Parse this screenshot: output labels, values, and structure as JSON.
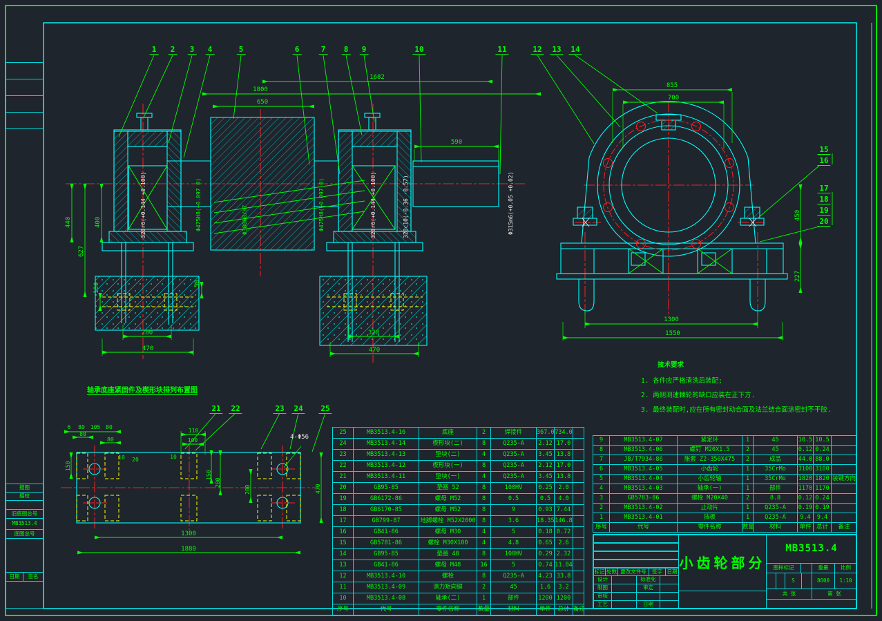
{
  "page": {
    "bg": "#1f252d",
    "line_cyan": "#00ffff",
    "line_green": "#00ff00",
    "line_red": "#ff0000",
    "line_yellow": "#ffff00",
    "line_white": "#e9e9e9"
  },
  "balloons": [
    "1",
    "2",
    "3",
    "4",
    "5",
    "6",
    "7",
    "8",
    "9",
    "10",
    "11",
    "12",
    "13",
    "14",
    "15",
    "16",
    "17",
    "18",
    "19",
    "20",
    "21",
    "22",
    "23",
    "24",
    "25"
  ],
  "dims": {
    "main": {
      "d1682": "1682",
      "d1800": "1800",
      "d650": "650",
      "d590": "590",
      "d440": "440",
      "d400": "400",
      "d627": "627",
      "d100": "100",
      "d50": "50",
      "d280": "280",
      "d470a": "470",
      "d320": "320",
      "d470b": "470"
    },
    "right_view": {
      "d855": "855",
      "d700": "700",
      "d450": "450",
      "d227": "227",
      "d1300": "1300",
      "d1550": "1550"
    },
    "plan": {
      "d110": "110",
      "d100": "100",
      "d6": "6",
      "d80a": "80",
      "d105": "105",
      "d80b": "80",
      "d80c": "80",
      "d80d": "80",
      "d150a": "150",
      "d10a": "10",
      "d20": "20",
      "d10b": "10",
      "d150b": "150",
      "d200": "200",
      "d280": "280",
      "d470": "470",
      "d1300": "1300",
      "d1880": "1880",
      "dholes": "4-Φ56"
    }
  },
  "fits": {
    "f475a": "Φ475H8(+0.097 0)",
    "f380": "Φ380H8/h7",
    "f475b": "Φ475H8(+0.097 0)",
    "f320ra": "320r6(+0.144 +0.100)",
    "f320rb": "320r6(+0.144 +0.100)",
    "f320c": "320c10(-0.36 -0.57)",
    "f315": "Φ315m6(+0.05 +0.02)"
  },
  "notes": {
    "heading": "技术要求",
    "items": [
      "1. 各件应严格清洗后装配;",
      "2. 两侧测速棘轮的缺口应装在正下方.",
      "3. 最终装配时,应在所有密封动合面及法兰结合面涂密封不干胶."
    ]
  },
  "caption_plan": "轴承底座紧固件及楔形块排列布置图",
  "bom_left": {
    "headers": [
      "序号",
      "代号",
      "零件名称",
      "数量",
      "材料",
      "单件",
      "总计",
      "备注"
    ],
    "rows": [
      {
        "no": "25",
        "code": "MB3513.4-16",
        "name": "底座",
        "qty": "2",
        "mat": "焊接件",
        "unit": "367.0",
        "total": "734.0",
        "rem": ""
      },
      {
        "no": "24",
        "code": "MB3513.4-14",
        "name": "楔形块(二)",
        "qty": "8",
        "mat": "Q235-A",
        "unit": "2.12",
        "total": "17.0",
        "rem": ""
      },
      {
        "no": "23",
        "code": "MB3513.4-13",
        "name": "垫块(二)",
        "qty": "4",
        "mat": "Q235-A",
        "unit": "3.45",
        "total": "13.8",
        "rem": ""
      },
      {
        "no": "22",
        "code": "MB3513.4-12",
        "name": "楔形块(一)",
        "qty": "8",
        "mat": "Q235-A",
        "unit": "2.12",
        "total": "17.0",
        "rem": ""
      },
      {
        "no": "21",
        "code": "MB3513.4-11",
        "name": "垫块(一)",
        "qty": "4",
        "mat": "Q235-A",
        "unit": "3.45",
        "total": "13.8",
        "rem": ""
      },
      {
        "no": "20",
        "code": "GB95-85",
        "name": "垫圈 52",
        "qty": "8",
        "mat": "100HV",
        "unit": "0.25",
        "total": "2.0",
        "rem": ""
      },
      {
        "no": "19",
        "code": "GB6172-86",
        "name": "螺母 M52",
        "qty": "8",
        "mat": "0.5",
        "unit": "0.5",
        "total": "4.0",
        "rem": ""
      },
      {
        "no": "18",
        "code": "GB6170-85",
        "name": "螺母 M52",
        "qty": "8",
        "mat": "9",
        "unit": "0.93",
        "total": "7.44",
        "rem": ""
      },
      {
        "no": "17",
        "code": "GB799-87",
        "name": "地脚螺栓 M52X2000",
        "qty": "8",
        "mat": "3.6",
        "unit": "18.35",
        "total": "146.8",
        "rem": ""
      },
      {
        "no": "16",
        "code": "GB41-86",
        "name": "螺母 M30",
        "qty": "4",
        "mat": "5",
        "unit": "0.18",
        "total": "0.72",
        "rem": ""
      },
      {
        "no": "15",
        "code": "GB5781-86",
        "name": "螺栓 M30X100",
        "qty": "4",
        "mat": "4.8",
        "unit": "0.65",
        "total": "2.6",
        "rem": ""
      },
      {
        "no": "14",
        "code": "GB95-85",
        "name": "垫圈 48",
        "qty": "8",
        "mat": "100HV",
        "unit": "0.29",
        "total": "2.32",
        "rem": ""
      },
      {
        "no": "13",
        "code": "GB41-86",
        "name": "螺母 M48",
        "qty": "16",
        "mat": "5",
        "unit": "0.74",
        "total": "11.84",
        "rem": ""
      },
      {
        "no": "12",
        "code": "MB3513.4-10",
        "name": "螺栓",
        "qty": "8",
        "mat": "Q235-A",
        "unit": "4.23",
        "total": "33.8",
        "rem": ""
      },
      {
        "no": "11",
        "code": "MB3513.4-09",
        "name": "测力矩向键",
        "qty": "2",
        "mat": "45",
        "unit": "1.6",
        "total": "3.2",
        "rem": ""
      },
      {
        "no": "10",
        "code": "MB3513.4-08",
        "name": "轴承(二)",
        "qty": "1",
        "mat": "部件",
        "unit": "1200",
        "total": "1200",
        "rem": ""
      }
    ]
  },
  "bom_right": {
    "headers": [
      "序号",
      "代号",
      "零件名称",
      "数量",
      "材料",
      "单件",
      "总计",
      "备注"
    ],
    "rows": [
      {
        "no": "9",
        "code": "MB3513.4-07",
        "name": "紧定环",
        "qty": "1",
        "mat": "45",
        "unit": "10.5",
        "total": "10.5",
        "rem": ""
      },
      {
        "no": "8",
        "code": "MB3513.4-06",
        "name": "螺钉 M20X1.5",
        "qty": "2",
        "mat": "45",
        "unit": "0.12",
        "total": "0.24",
        "rem": ""
      },
      {
        "no": "7",
        "code": "JB/T7934-86",
        "name": "胀套 Z2-350X475",
        "qty": "2",
        "mat": "成品",
        "unit": "44.0",
        "total": "88.0",
        "rem": ""
      },
      {
        "no": "6",
        "code": "MB3513.4-05",
        "name": "小齿轮",
        "qty": "1",
        "mat": "35CrMo",
        "unit": "3100",
        "total": "3100",
        "rem": ""
      },
      {
        "no": "5",
        "code": "MB3513.4-04",
        "name": "小齿轮轴",
        "qty": "1",
        "mat": "35CrMo",
        "unit": "1820",
        "total": "1820",
        "rem": "装键方向"
      },
      {
        "no": "4",
        "code": "MB3513.4-03",
        "name": "轴承(一)",
        "qty": "1",
        "mat": "部件",
        "unit": "1170",
        "total": "1170",
        "rem": ""
      },
      {
        "no": "3",
        "code": "GB5783-86",
        "name": "螺栓 M20X40",
        "qty": "2",
        "mat": "8.8",
        "unit": "0.12",
        "total": "0.24",
        "rem": ""
      },
      {
        "no": "2",
        "code": "MB3513.4-02",
        "name": "止动片",
        "qty": "1",
        "mat": "Q235-A",
        "unit": "0.19",
        "total": "0.19",
        "rem": ""
      },
      {
        "no": "1",
        "code": "MB3513.4-01",
        "name": "挡板",
        "qty": "1",
        "mat": "Q235-A",
        "unit": "9.4",
        "total": "9.4",
        "rem": ""
      }
    ]
  },
  "title_block": {
    "product": "小齿轮部分",
    "drawing_no": "MB3513.4",
    "mark_label": "图样标记",
    "weight_label": "重量",
    "scale_label": "比例",
    "stage": "S",
    "weight": "8600",
    "scale": "1:10",
    "total_sheets": "共 张",
    "sheet": "第 张",
    "rev_headers": [
      "标记",
      "处数",
      "更改文件号",
      "签字",
      "日期"
    ],
    "roles": [
      "设计",
      "制图",
      "审核",
      "工艺"
    ],
    "roles2": [
      "标准化",
      "审定",
      "",
      "日期"
    ]
  },
  "margin": {
    "r1": "描图",
    "r2": "描校",
    "old_no_label": "旧底图总号",
    "old_no": "MB3513.4",
    "no_label": "底图总号",
    "date": "日期",
    "sign": "签名"
  }
}
